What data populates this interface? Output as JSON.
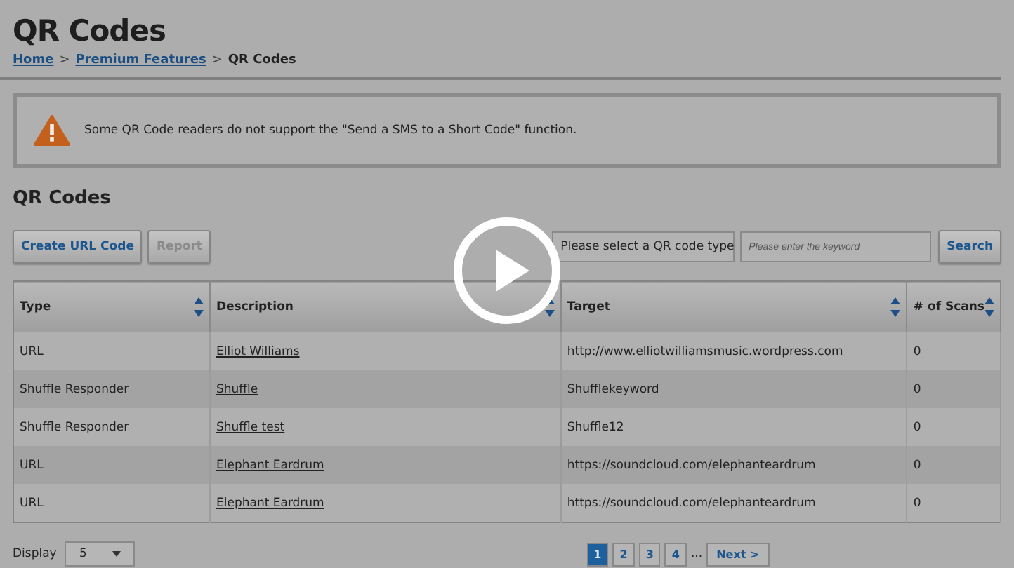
{
  "page_title": "QR Codes",
  "breadcrumb_separator": ">",
  "breadcrumb": [
    {
      "label": "Home",
      "link": true
    },
    {
      "label": "Premium Features",
      "link": true
    },
    {
      "label": "QR Codes",
      "link": false
    }
  ],
  "alert": {
    "kind": "warning",
    "text": "Some QR Code readers do not support the \"Send a SMS to a Short Code\" function."
  },
  "section_title": "QR Codes",
  "toolbar": {
    "buttons": [
      {
        "label": "Create URL Code",
        "disabled": false
      },
      {
        "label": "Report",
        "disabled": true
      }
    ],
    "type_select": "Please select a QR code type",
    "keyword": {
      "placeholder": "Please enter the keyword"
    },
    "search_button": "Search"
  },
  "table": {
    "columns": [
      "Type",
      "Description",
      "Target",
      "# of Scans"
    ],
    "rows": [
      {
        "type": "URL",
        "description": "Elliot Williams",
        "target": "http://www.elliotwilliamsmusic.wordpress.com",
        "scans": "0"
      },
      {
        "type": "Shuffle Responder",
        "description": "Shuffle",
        "target": "Shufflekeyword",
        "scans": "0"
      },
      {
        "type": "Shuffle Responder",
        "description": "Shuffle test",
        "target": "Shuffle12",
        "scans": "0"
      },
      {
        "type": "URL",
        "description": "Elephant Eardrum",
        "target": "https://soundcloud.com/elephanteardrum",
        "scans": "0"
      },
      {
        "type": "URL",
        "description": "Elephant Eardrum",
        "target": "https://soundcloud.com/elephanteardrum",
        "scans": "0"
      }
    ]
  },
  "display": {
    "label": "Display",
    "value": "5"
  },
  "pagination": {
    "pages": [
      {
        "label": "1",
        "selected": true
      },
      {
        "label": "2",
        "selected": false
      },
      {
        "label": "3",
        "selected": false
      },
      {
        "label": "4",
        "selected": false
      }
    ],
    "ellipsis": "...",
    "next": "Next >"
  },
  "video_overlay": {
    "play_button": true
  }
}
